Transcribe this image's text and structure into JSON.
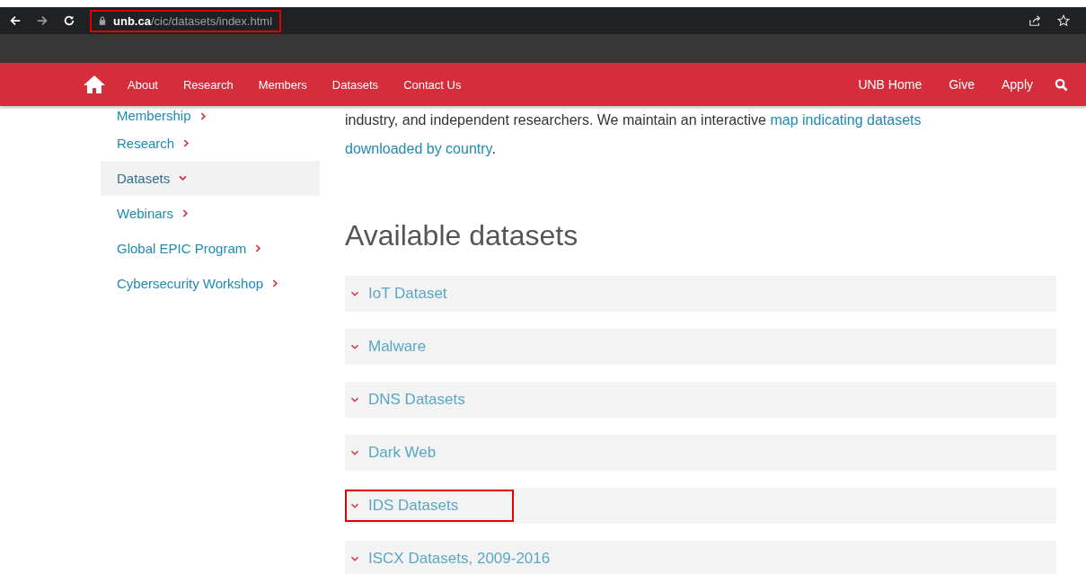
{
  "browser": {
    "url_host": "unb.ca",
    "url_path": "/cic/datasets/index.html",
    "url_highlighted": true
  },
  "nav": {
    "left": [
      {
        "label": "About"
      },
      {
        "label": "Research"
      },
      {
        "label": "Members"
      },
      {
        "label": "Datasets"
      },
      {
        "label": "Contact Us"
      }
    ],
    "right": [
      {
        "label": "UNB Home"
      },
      {
        "label": "Give"
      },
      {
        "label": "Apply"
      }
    ]
  },
  "sidebar": {
    "items": [
      {
        "label": "Membership",
        "selected": false
      },
      {
        "label": "Research",
        "selected": false
      },
      {
        "label": "Datasets",
        "selected": true
      },
      {
        "label": "Webinars",
        "selected": false
      },
      {
        "label": "Global EPIC Program",
        "selected": false
      },
      {
        "label": "Cybersecurity Workshop",
        "selected": false
      }
    ]
  },
  "intro": {
    "text": "industry, and independent researchers. We maintain an interactive ",
    "link": [
      "map indicating datasets",
      "downloaded by country"
    ],
    "end": "."
  },
  "heading": "Available datasets",
  "datasets": [
    {
      "label": "IoT Dataset",
      "highlighted": false
    },
    {
      "label": "Malware",
      "highlighted": false
    },
    {
      "label": "DNS Datasets",
      "highlighted": false
    },
    {
      "label": "Dark Web",
      "highlighted": false
    },
    {
      "label": "IDS Datasets",
      "highlighted": true
    },
    {
      "label": "ISCX Datasets, 2009-2016",
      "highlighted": false
    }
  ]
}
